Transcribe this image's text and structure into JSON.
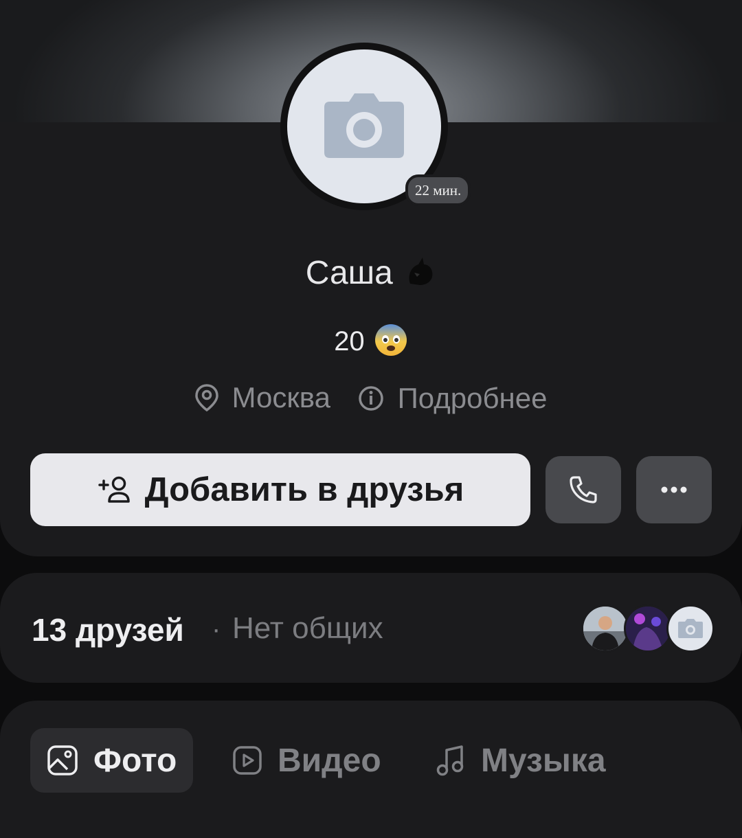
{
  "profile": {
    "last_seen": "22 мин.",
    "name": "Саша",
    "status": "20",
    "city": "Москва",
    "details_link": "Подробнее"
  },
  "actions": {
    "add_friend": "Добавить в друзья"
  },
  "friends": {
    "count_label": "13 друзей",
    "separator": "·",
    "common_label": "Нет общих"
  },
  "tabs": [
    {
      "label": "Фото",
      "icon": "image-icon",
      "active": true
    },
    {
      "label": "Видео",
      "icon": "video-icon",
      "active": false
    },
    {
      "label": "Музыка",
      "icon": "music-icon",
      "active": false
    }
  ],
  "colors": {
    "background": "#0c0c0d",
    "card": "#1b1b1d",
    "primary_button": "#e8e8ec",
    "secondary_button": "#48494d",
    "muted_text": "#8b8c90"
  }
}
